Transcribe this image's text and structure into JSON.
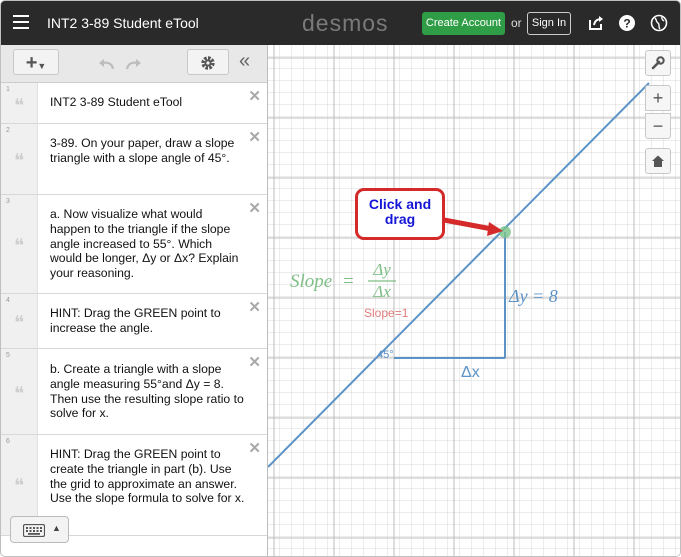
{
  "app": {
    "title": "INT2 3-89 Student eTool",
    "logo": "desmos",
    "create_account": "Create Account",
    "or": "or",
    "sign_in": "Sign In"
  },
  "toolbar": {
    "add_icon": "plus-icon",
    "collapse_icon": "double-chevron-left-icon"
  },
  "items": [
    {
      "num": "1",
      "text": "INT2 3-89 Student eTool"
    },
    {
      "num": "2",
      "text": "3-89. On your paper, draw a slope triangle with a slope angle of 45°."
    },
    {
      "num": "3",
      "text": "a. Now visualize what would happen to the triangle if the slope angle increased to 55°. Which would be longer, Δy or Δx? Explain your reasoning."
    },
    {
      "num": "4",
      "text": "HINT: Drag the GREEN point to increase the angle."
    },
    {
      "num": "5",
      "text": "b. Create a triangle with a slope angle measuring 55°and Δy = 8. Then use the resulting slope ratio to solve for x."
    },
    {
      "num": "6",
      "text": "HINT: Drag the GREEN point to create the triangle in part (b). Use the grid to approximate an answer. Use the slope formula to solve for x."
    }
  ],
  "graph": {
    "slope_word": "Slope",
    "equals": "=",
    "delta_y": "Δy",
    "delta_x": "Δx",
    "slope_value": "Slope=1",
    "angle_label": "45°",
    "dy_label": "Δy = 8",
    "dx_label": "Δx",
    "line_color": "#5b93c7",
    "point_color": "#7cc48b",
    "formula_color": "#7fbf87",
    "slope_value_color": "#e07c7c"
  },
  "callout": {
    "line1": "Click and",
    "line2": "drag"
  }
}
